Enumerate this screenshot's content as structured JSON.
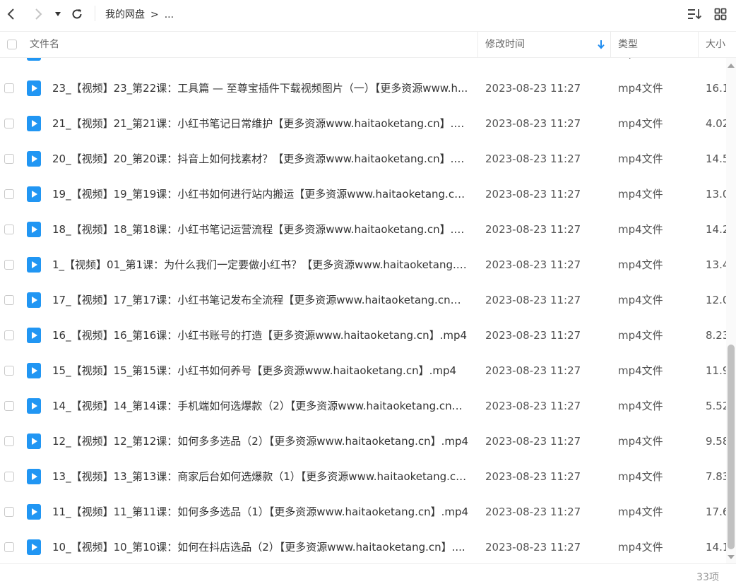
{
  "toolbar": {
    "breadcrumb": {
      "root": "我的网盘",
      "separator": ">",
      "tail": "..."
    }
  },
  "header": {
    "col_name": "文件名",
    "col_time": "修改时间",
    "col_type": "类型",
    "col_size": "大小",
    "sort_icon": "arrow-down-icon"
  },
  "partial_row": {
    "type": "mp4文件"
  },
  "files": [
    {
      "name": "23_【视频】23_第22课：工具篇 — 至尊宝插件下载视频图片（一）【更多资源www.h...",
      "time": "2023-08-23 11:27",
      "type": "mp4文件",
      "size": "16.1"
    },
    {
      "name": "21_【视频】21_第21课：小红书笔记日常维护【更多资源www.haitaoketang.cn】.m...",
      "time": "2023-08-23 11:27",
      "type": "mp4文件",
      "size": "4.02"
    },
    {
      "name": "20_【视频】20_第20课：抖音上如何找素材？【更多资源www.haitaoketang.cn】.m...",
      "time": "2023-08-23 11:27",
      "type": "mp4文件",
      "size": "14.5"
    },
    {
      "name": "19_【视频】19_第19课：小红书如何进行站内搬运【更多资源www.haitaoketang.cn...",
      "time": "2023-08-23 11:27",
      "type": "mp4文件",
      "size": "13.0"
    },
    {
      "name": "18_【视频】18_第18课：小红书笔记运营流程【更多资源www.haitaoketang.cn】.m...",
      "time": "2023-08-23 11:27",
      "type": "mp4文件",
      "size": "14.2"
    },
    {
      "name": "1_【视频】01_第1课：为什么我们一定要做小红书？【更多资源www.haitaoketang.c...",
      "time": "2023-08-23 11:27",
      "type": "mp4文件",
      "size": "13.4"
    },
    {
      "name": "17_【视频】17_第17课：小红书笔记发布全流程【更多资源www.haitaoketang.cn】....",
      "time": "2023-08-23 11:27",
      "type": "mp4文件",
      "size": "12.0"
    },
    {
      "name": "16_【视频】16_第16课：小红书账号的打造【更多资源www.haitaoketang.cn】.mp4",
      "time": "2023-08-23 11:27",
      "type": "mp4文件",
      "size": "8.23"
    },
    {
      "name": "15_【视频】15_第15课：小红书如何养号【更多资源www.haitaoketang.cn】.mp4",
      "time": "2023-08-23 11:27",
      "type": "mp4文件",
      "size": "11.9"
    },
    {
      "name": "14_【视频】14_第14课：手机端如何选爆款（2）【更多资源www.haitaoketang.cn】...",
      "time": "2023-08-23 11:27",
      "type": "mp4文件",
      "size": "5.52"
    },
    {
      "name": "12_【视频】12_第12课：如何多多选品（2）【更多资源www.haitaoketang.cn】.mp4",
      "time": "2023-08-23 11:27",
      "type": "mp4文件",
      "size": "9.58"
    },
    {
      "name": "13_【视频】13_第13课：商家后台如何选爆款（1）【更多资源www.haitaoketang.cn...",
      "time": "2023-08-23 11:27",
      "type": "mp4文件",
      "size": "7.83"
    },
    {
      "name": "11_【视频】11_第11课：如何多多选品（1）【更多资源www.haitaoketang.cn】.mp4",
      "time": "2023-08-23 11:27",
      "type": "mp4文件",
      "size": "17.6"
    },
    {
      "name": "10_【视频】10_第10课：如何在抖店选品（2）【更多资源www.haitaoketang.cn】....",
      "time": "2023-08-23 11:27",
      "type": "mp4文件",
      "size": "14.1"
    }
  ],
  "footer": {
    "count": "33项"
  },
  "colors": {
    "accent": "#1e8cf0",
    "icon_blue": "#2196f3"
  }
}
